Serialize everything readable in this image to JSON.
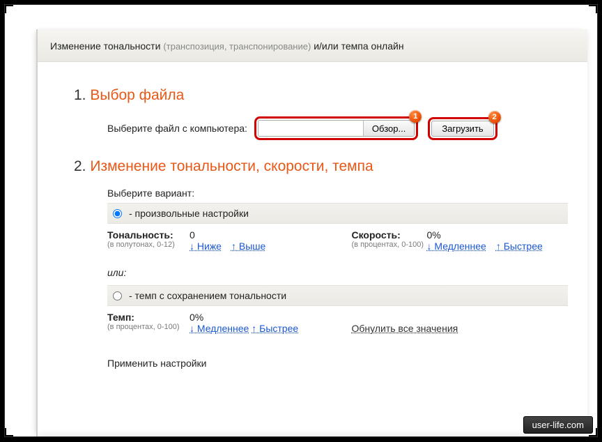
{
  "header": {
    "prefix": "Изменение тональности ",
    "paren": "(транспозиция, транспонирование)",
    "suffix": " и/или темпа онлайн"
  },
  "step1": {
    "num": "1.",
    "title": "Выбор файла",
    "label": "Выберите файл с компьютера:",
    "browse": "Обзор...",
    "upload": "Загрузить",
    "badge1": "1",
    "badge2": "2"
  },
  "step2": {
    "num": "2.",
    "title": "Изменение тональности, скорости, темпа",
    "variant_label": "Выберите вариант:",
    "option_custom": " -  произвольные настройки",
    "option_tempo": " -  темп с сохранением тональности",
    "or": "или:",
    "tonality": {
      "label": "Тональность:",
      "value": "0",
      "sub": "(в полутонах, 0-12)",
      "down": "↓ Ниже",
      "up": "↑ Выше"
    },
    "speed": {
      "label": "Скорость:",
      "value": "0%",
      "sub": "(в процентах, 0-100)",
      "down": "↓ Медленнее",
      "up": "↑ Быстрее"
    },
    "tempo": {
      "label": "Темп:",
      "value": "0%",
      "sub": "(в процентах, 0-100)",
      "down": "↓ Медленнее",
      "up": "↑ Быстрее"
    },
    "reset": "Обнулить все значения",
    "apply": "Применить настройки"
  },
  "watermark": "user-life.com"
}
